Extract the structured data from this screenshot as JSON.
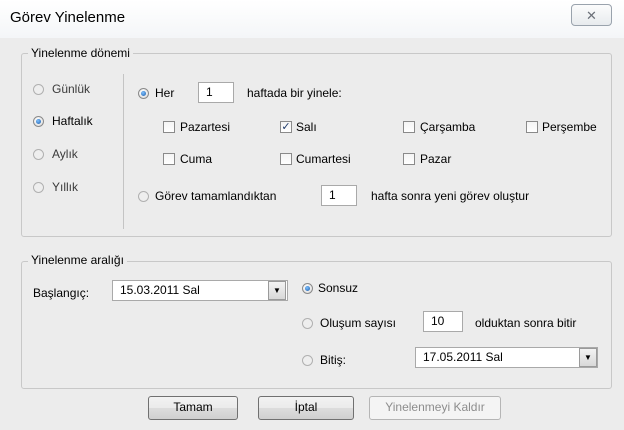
{
  "window": {
    "title": "Görev Yinelenme",
    "close_icon": "close-icon"
  },
  "pattern_group": {
    "legend": "Yinelenme dönemi",
    "frequencies": [
      "Günlük",
      "Haftalık",
      "Aylık",
      "Yıllık"
    ],
    "selected_frequency": "Haftalık",
    "every_label": "Her",
    "every_value": "1",
    "every_suffix": "haftada bir yinele:",
    "days": [
      {
        "label": "Pazartesi",
        "checked": false
      },
      {
        "label": "Salı",
        "checked": true
      },
      {
        "label": "Çarşamba",
        "checked": false
      },
      {
        "label": "Perşembe",
        "checked": false
      },
      {
        "label": "Cuma",
        "checked": false
      },
      {
        "label": "Cumartesi",
        "checked": false
      },
      {
        "label": "Pazar",
        "checked": false
      }
    ],
    "regen_label": "Görev tamamlandıktan",
    "regen_value": "1",
    "regen_suffix": "hafta sonra yeni görev oluştur"
  },
  "range_group": {
    "legend": "Yinelenme aralığı",
    "start_label": "Başlangıç:",
    "start_value": "15.03.2011 Sal",
    "no_end_label": "Sonsuz",
    "occurrences_label": "Oluşum sayısı",
    "occurrences_value": "10",
    "occurrences_suffix": "olduktan sonra bitir",
    "end_by_label": "Bitiş:",
    "end_by_value": "17.05.2011 Sal",
    "selected_option": "Sonsuz"
  },
  "buttons": {
    "ok": "Tamam",
    "cancel": "İptal",
    "remove": "Yinelenmeyi Kaldır"
  }
}
